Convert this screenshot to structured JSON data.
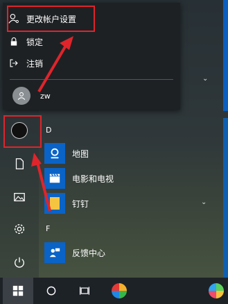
{
  "account_menu": {
    "change_settings_label": "更改帐户设置",
    "lock_label": "锁定",
    "signout_label": "注销",
    "username": "zw"
  },
  "app_list": {
    "group_d": "D",
    "group_f": "F",
    "apps": [
      {
        "label": "地图",
        "icon": "maps-icon"
      },
      {
        "label": "电影和电视",
        "icon": "movies-tv-icon"
      },
      {
        "label": "钉钉",
        "icon": "dingtalk-icon"
      },
      {
        "label": "反馈中心",
        "icon": "feedback-hub-icon"
      }
    ]
  },
  "rail": {
    "icons": [
      "app-logo-icon",
      "documents-icon",
      "pictures-icon",
      "settings-icon",
      "power-icon"
    ]
  },
  "taskbar": {
    "icons": [
      "windows-start-icon",
      "search-circle-icon",
      "task-view-icon",
      "app-pinwheel-icon",
      "app-pinwheel-2-icon"
    ]
  },
  "colors": {
    "annotation_red": "#e0242b",
    "tile_blue": "#0a63c7"
  }
}
